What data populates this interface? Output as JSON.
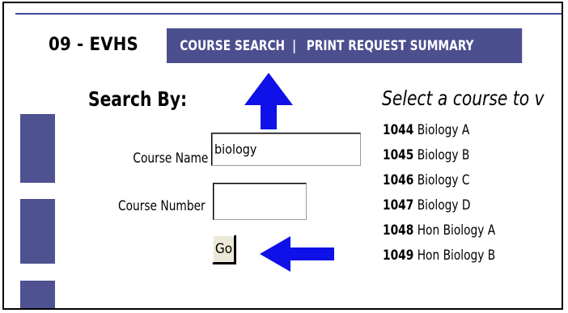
{
  "header": {
    "school_label": "09 - EVHS",
    "tabs": [
      {
        "label": "COURSE SEARCH"
      },
      {
        "label": "PRINT REQUEST SUMMARY"
      }
    ],
    "separator": "|"
  },
  "search": {
    "title": "Search By:",
    "course_name_label": "Course Name",
    "course_name_value": "biology",
    "course_number_label": "Course Number",
    "course_number_value": "",
    "go_label": "Go"
  },
  "results": {
    "heading": "Select a course to v",
    "courses": [
      {
        "number": "1044",
        "name": "Biology A"
      },
      {
        "number": "1045",
        "name": "Biology B"
      },
      {
        "number": "1046",
        "name": "Biology C"
      },
      {
        "number": "1047",
        "name": "Biology D"
      },
      {
        "number": "1048",
        "name": "Hon Biology A"
      },
      {
        "number": "1049",
        "name": "Hon Biology B"
      }
    ]
  },
  "colors": {
    "nav_bg": "#4c4f8e",
    "annotation_arrow": "#1010e8"
  },
  "icons": [
    "up-arrow-annotation-icon",
    "left-arrow-annotation-icon"
  ]
}
